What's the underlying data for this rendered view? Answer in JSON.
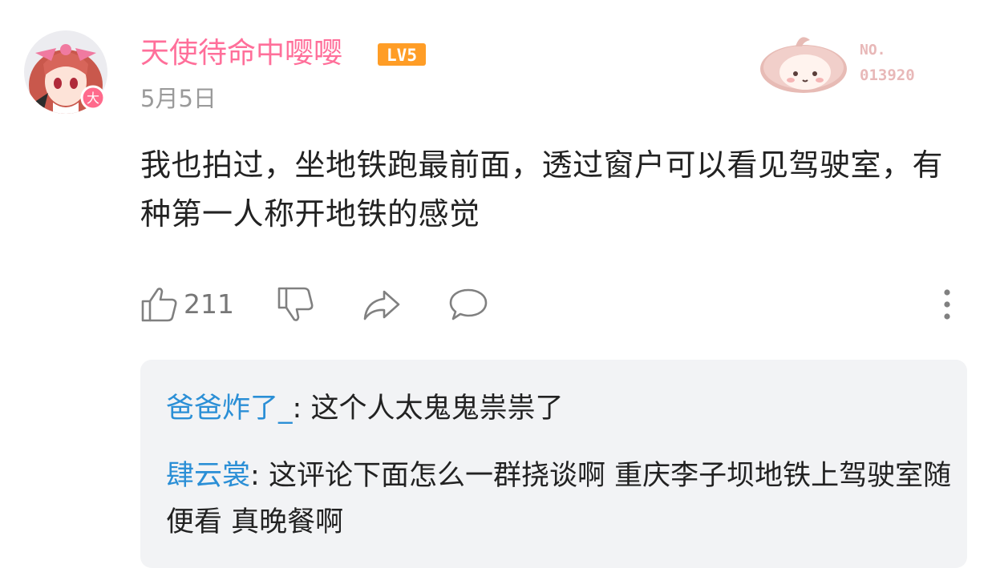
{
  "comment": {
    "username": "天使待命中嘤嘤",
    "level_badge": "LV5",
    "date": "5月5日",
    "avatar_badge": "大",
    "fan_badge": {
      "label": "NO.",
      "number": "013920"
    },
    "text": "我也拍过，坐地铁跑最前面，透过窗户可以看见驾驶室，有种第一人称开地铁的感觉",
    "like_count": "211"
  },
  "icons": {
    "like": "thumbs-up-icon",
    "dislike": "thumbs-down-icon",
    "share": "share-icon",
    "reply": "reply-icon",
    "more": "more-vertical-icon"
  },
  "replies": [
    {
      "user": "爸爸炸了_",
      "sep": ": ",
      "text": "这个人太鬼鬼祟祟了"
    },
    {
      "user": "肆云裳",
      "sep": ": ",
      "text": "这评论下面怎么一群挠谈啊  重庆李子坝地铁上驾驶室随便看  真晚餐啊"
    }
  ],
  "colors": {
    "username": "#ff6f9a",
    "level_badge": "#ff9d26",
    "reply_user": "#2b8fd6",
    "reply_box_bg": "#f2f3f5",
    "icon": "#808080",
    "fan_badge_text": "#e8b8b8"
  }
}
